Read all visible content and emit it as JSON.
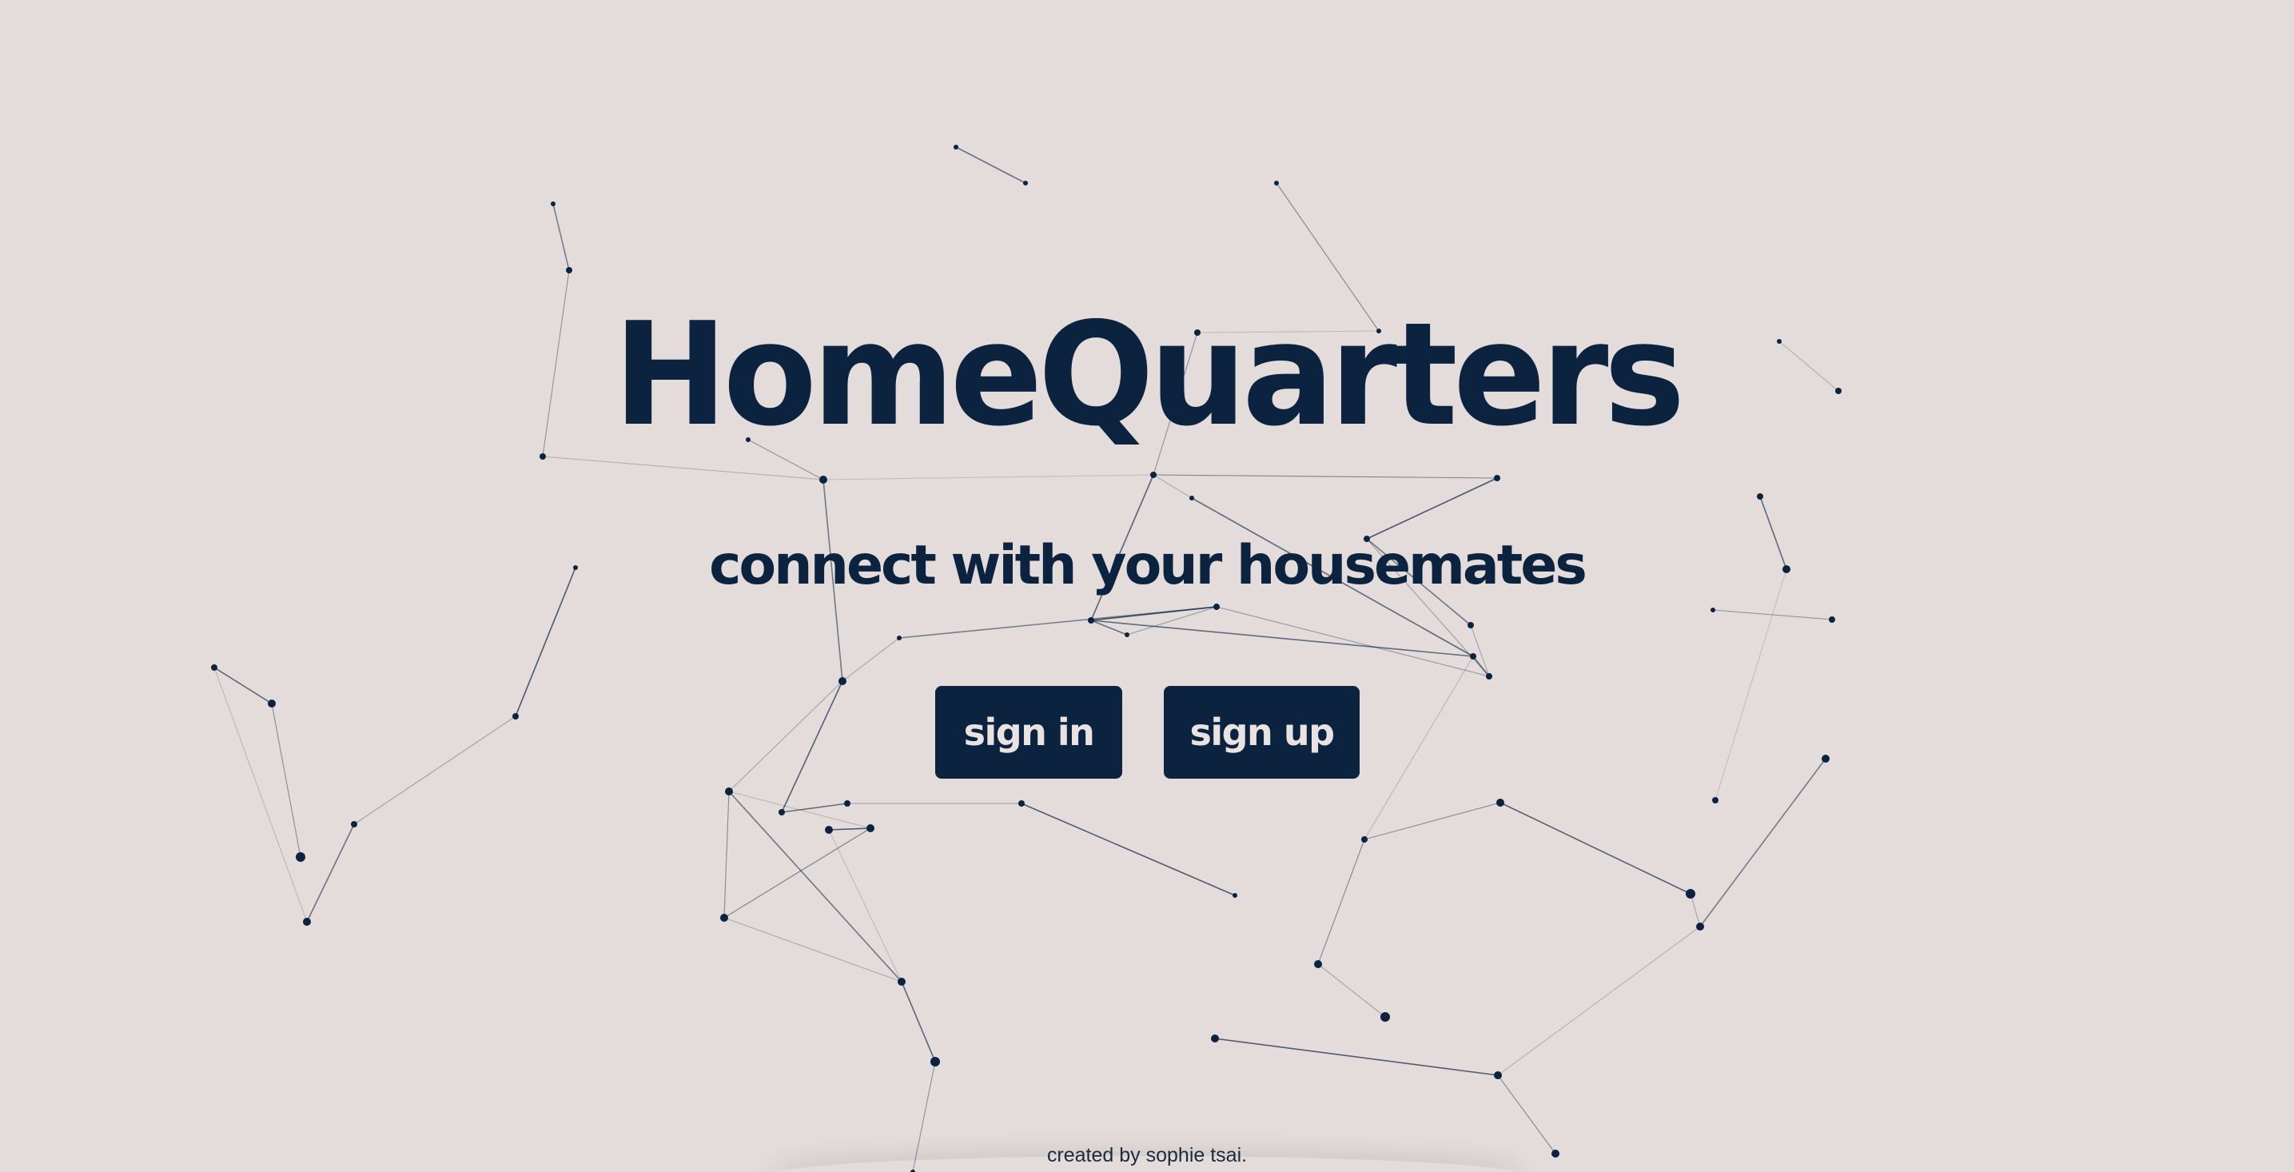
{
  "app": {
    "title": "HomeQuarters",
    "tagline": "connect with your housemates"
  },
  "actions": {
    "sign_in_label": "sign in",
    "sign_up_label": "sign up"
  },
  "footer": {
    "credit": "created by sophie tsai."
  },
  "colors": {
    "background": "#e3dcdb",
    "primary": "#0c2340",
    "button_text": "#e8e2e1"
  },
  "background_animation": {
    "type": "particle-network"
  }
}
